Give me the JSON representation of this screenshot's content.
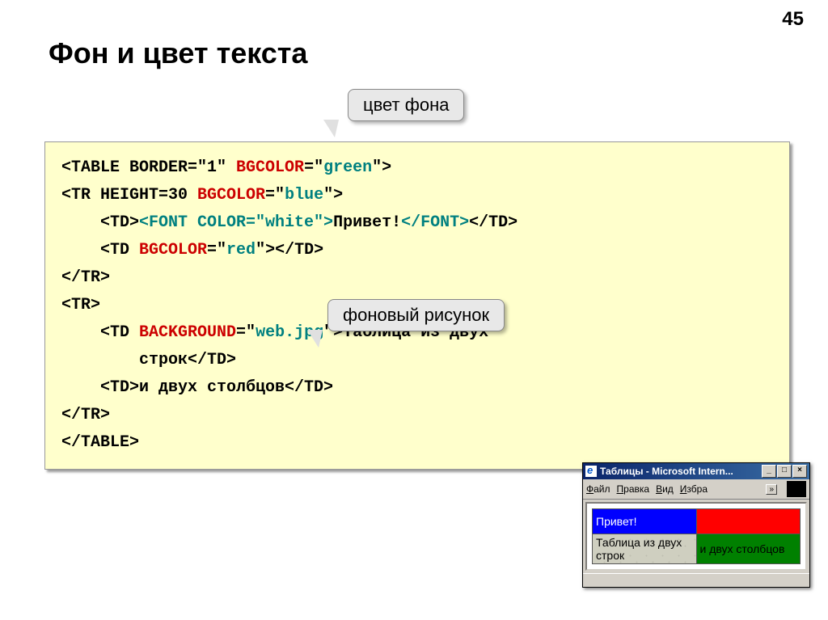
{
  "page_number": "45",
  "title": "Фон и цвет текста",
  "callouts": {
    "bg_color": "цвет фона",
    "bg_image": "фоновый рисунок"
  },
  "code": {
    "l1_a": "<TABLE BORDER=\"1\" ",
    "l1_b": "BGCOLOR",
    "l1_c": "=\"",
    "l1_d": "green",
    "l1_e": "\">",
    "l2_a": "<TR HEIGHT=30 ",
    "l2_b": "BGCOLOR",
    "l2_c": "=\"",
    "l2_d": "blue",
    "l2_e": "\">",
    "l3_a": "    <TD>",
    "l3_b": "<FONT COLOR=\"white\">",
    "l3_c": "Привет!",
    "l3_d": "</FONT>",
    "l3_e": "</TD>",
    "l4_a": "    <TD ",
    "l4_b": "BGCOLOR",
    "l4_c": "=\"",
    "l4_d": "red",
    "l4_e": "\"></TD>",
    "l5": "</TR>",
    "l6": "<TR>",
    "l7_a": "    <TD ",
    "l7_b": "BACKGROUND",
    "l7_c": "=\"",
    "l7_d": "web.jpg",
    "l7_e": "\">Таблица из двух",
    "l8": "        строк</TD>",
    "l9": "    <TD>и двух столбцов</TD>",
    "l10": "</TR>",
    "l11": "</TABLE>"
  },
  "browser": {
    "title": "Таблицы - Microsoft Intern...",
    "menu": {
      "file": "Файл",
      "edit": "Правка",
      "view": "Вид",
      "fav": "Избра"
    },
    "cells": {
      "c1": "Привет!",
      "c2": "",
      "c3": "Таблица из двух строк",
      "c4": "и двух столбцов"
    }
  }
}
